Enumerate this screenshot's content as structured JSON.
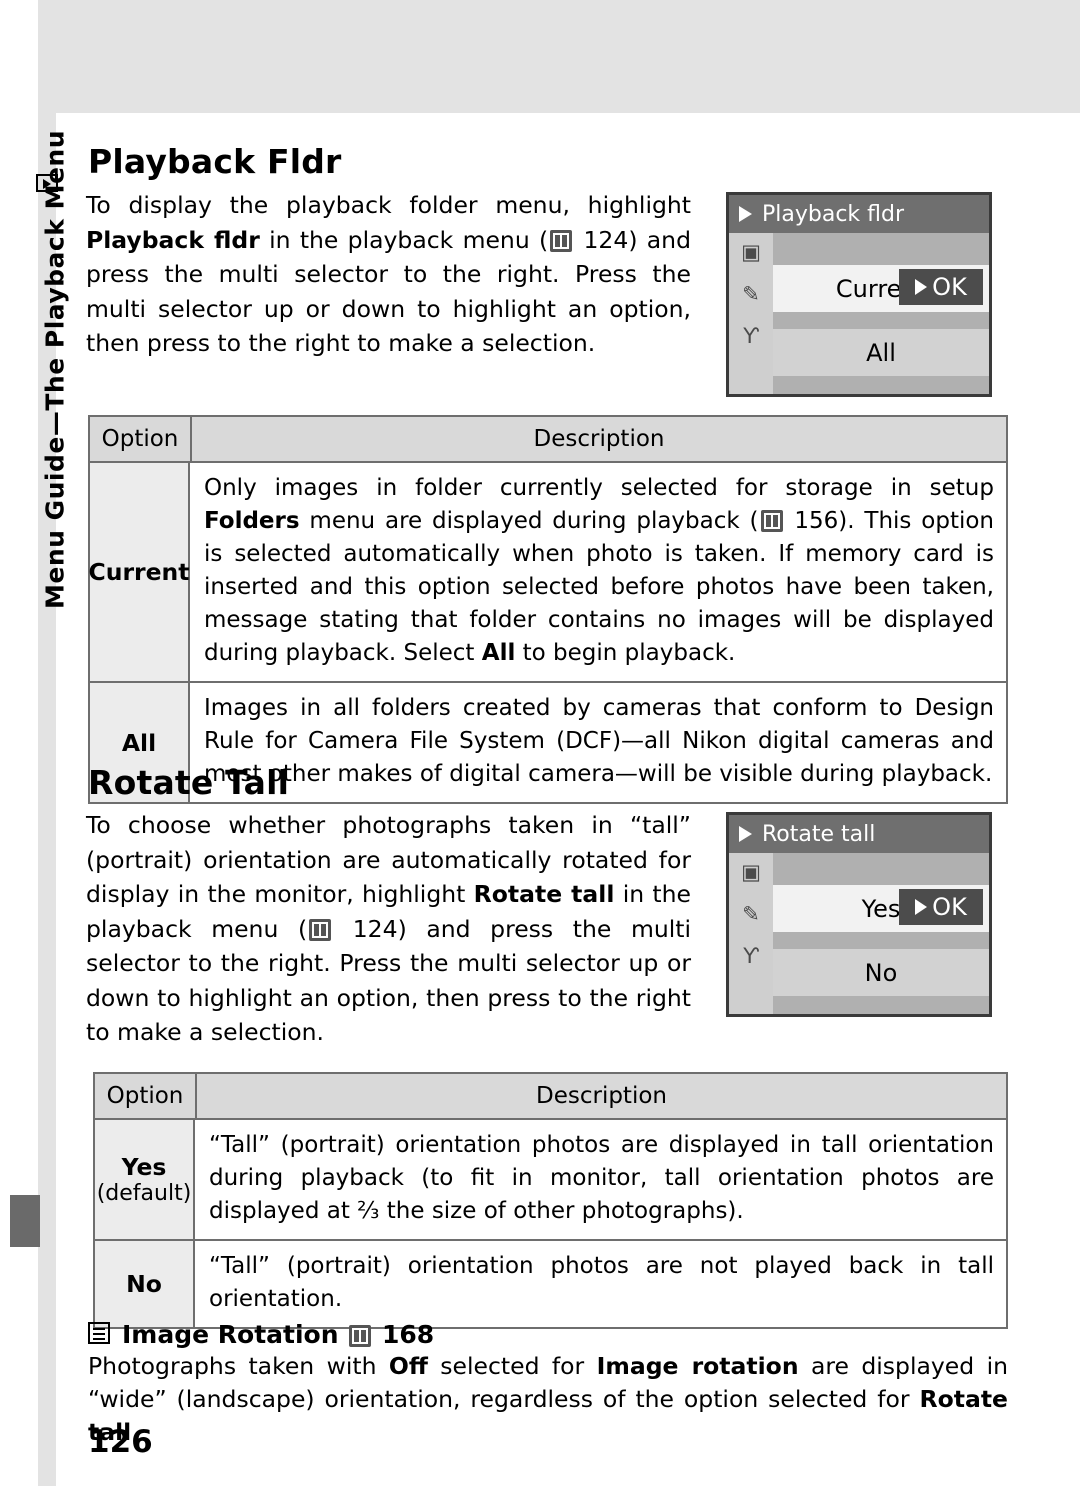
{
  "sidebar": {
    "vertical_label": "Menu Guide—The Playback Menu",
    "play_icon": "playback-icon"
  },
  "page_number": "126",
  "sections": [
    {
      "title": "Playback Fldr",
      "body_html": "To display the playback folder menu, highlight <b>Playback fldr</b> in the playback menu (BOOK 124) and press the multi selector to the right.  Press the multi selector up or down to highlight an option, then press to the right to make a selection.",
      "lcd": {
        "header": "Playback fldr",
        "rows": [
          {
            "label": "Current",
            "ok": "OK",
            "selected": true
          },
          {
            "label": "All",
            "ok": "",
            "selected": false
          }
        ]
      },
      "table": {
        "headers": {
          "option": "Option",
          "description": "Description"
        },
        "rows": [
          {
            "option": "Current",
            "sub": "",
            "desc_html": "Only images in folder currently selected for storage in setup <b>Folders</b> menu are displayed during playback (BOOK 156).  This option is selected automatically when photo is taken.  If memory card is inserted and this option selected before photos have been taken, message stating that folder contains no images will be displayed during playback.  Select <b>All</b> to begin playback."
          },
          {
            "option": "All",
            "sub": "",
            "desc_html": "Images in all folders created by cameras that conform to Design Rule for Camera File System (DCF)—all Nikon digital cameras and most other makes of digital camera—will be visible during playback."
          }
        ]
      }
    },
    {
      "title": "Rotate Tall",
      "body_html": "To choose whether photographs taken in “tall” (portrait) orientation are automatically rotated for display in the monitor, highlight <b>Rotate tall</b> in the playback menu (BOOK 124) and press the multi selector to the right.  Press the multi selector up or down to highlight an option, then press to the right to make a selection.",
      "lcd": {
        "header": "Rotate tall",
        "rows": [
          {
            "label": "Yes",
            "ok": "OK",
            "selected": true
          },
          {
            "label": "No",
            "ok": "",
            "selected": false
          }
        ]
      },
      "table": {
        "headers": {
          "option": "Option",
          "description": "Description"
        },
        "rows": [
          {
            "option": "Yes",
            "sub": "(default)",
            "desc_html": "“Tall” (portrait) orientation photos are displayed in tall orientation during playback (to fit in monitor, tall orientation photos are displayed at ⅔ the size of other photographs)."
          },
          {
            "option": "No",
            "sub": "",
            "desc_html": "“Tall” (portrait) orientation photos are not played back in tall orientation."
          }
        ]
      }
    }
  ],
  "note": {
    "title": "Image Rotation",
    "page_ref": "168",
    "body_html": "Photographs taken with <b>Off</b> selected for <b>Image rotation</b> are displayed in “wide” (landscape) orientation, regardless of the option selected for <b>Rotate tall</b>."
  }
}
